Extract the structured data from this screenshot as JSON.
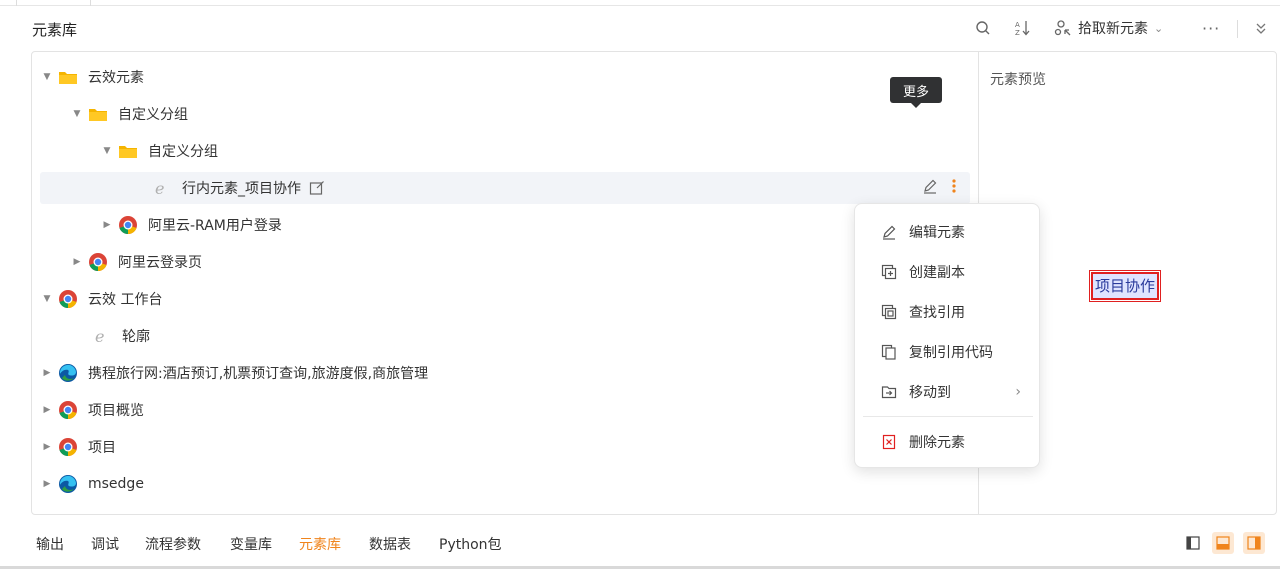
{
  "header": {
    "title": "元素库",
    "pick_label": "拾取新元素",
    "more_icon": "ellipsis-icon"
  },
  "tree": {
    "rows": [
      {
        "label": "云效元素",
        "icon": "folder-icon",
        "expanded": true
      },
      {
        "label": "自定义分组",
        "icon": "folder-icon",
        "expanded": true
      },
      {
        "label": "自定义分组",
        "icon": "folder-icon",
        "expanded": true
      },
      {
        "label": "行内元素_项目协作",
        "icon": "ie-element-icon"
      },
      {
        "label": "阿里云-RAM用户登录",
        "icon": "chrome-icon",
        "expanded": false
      },
      {
        "label": "阿里云登录页",
        "icon": "chrome-icon",
        "expanded": false
      },
      {
        "label": "云效 工作台",
        "icon": "chrome-icon",
        "expanded": true
      },
      {
        "label": "轮廓",
        "icon": "ie-element-icon"
      },
      {
        "label": "携程旅行网:酒店预订,机票预订查询,旅游度假,商旅管理",
        "icon": "edge-icon",
        "expanded": false
      },
      {
        "label": "项目概览",
        "icon": "chrome-icon",
        "expanded": false
      },
      {
        "label": "项目",
        "icon": "chrome-icon",
        "expanded": false
      },
      {
        "label": "msedge",
        "icon": "edge-icon",
        "expanded": false
      }
    ]
  },
  "tooltip": {
    "text": "更多"
  },
  "context_menu": {
    "items": [
      {
        "label": "编辑元素",
        "icon": "pencil-icon"
      },
      {
        "label": "创建副本",
        "icon": "add-copy-icon"
      },
      {
        "label": "查找引用",
        "icon": "find-reference-icon"
      },
      {
        "label": "复制引用代码",
        "icon": "copy-icon"
      },
      {
        "label": "移动到",
        "icon": "move-folder-icon",
        "arrow": "›"
      },
      {
        "label": "删除元素",
        "icon": "trash-icon"
      }
    ]
  },
  "preview": {
    "title": "元素预览",
    "sample_text": "项目协作"
  },
  "bottom_tabs": [
    {
      "label": "输出"
    },
    {
      "label": "调试"
    },
    {
      "label": "流程参数"
    },
    {
      "label": "变量库"
    },
    {
      "label": "元素库",
      "active": true
    },
    {
      "label": "数据表"
    },
    {
      "label": "Python包"
    }
  ],
  "colors": {
    "accent": "#f0841c",
    "folder": "#f5b400",
    "danger": "#e02020",
    "tooltip_bg": "#303133"
  }
}
